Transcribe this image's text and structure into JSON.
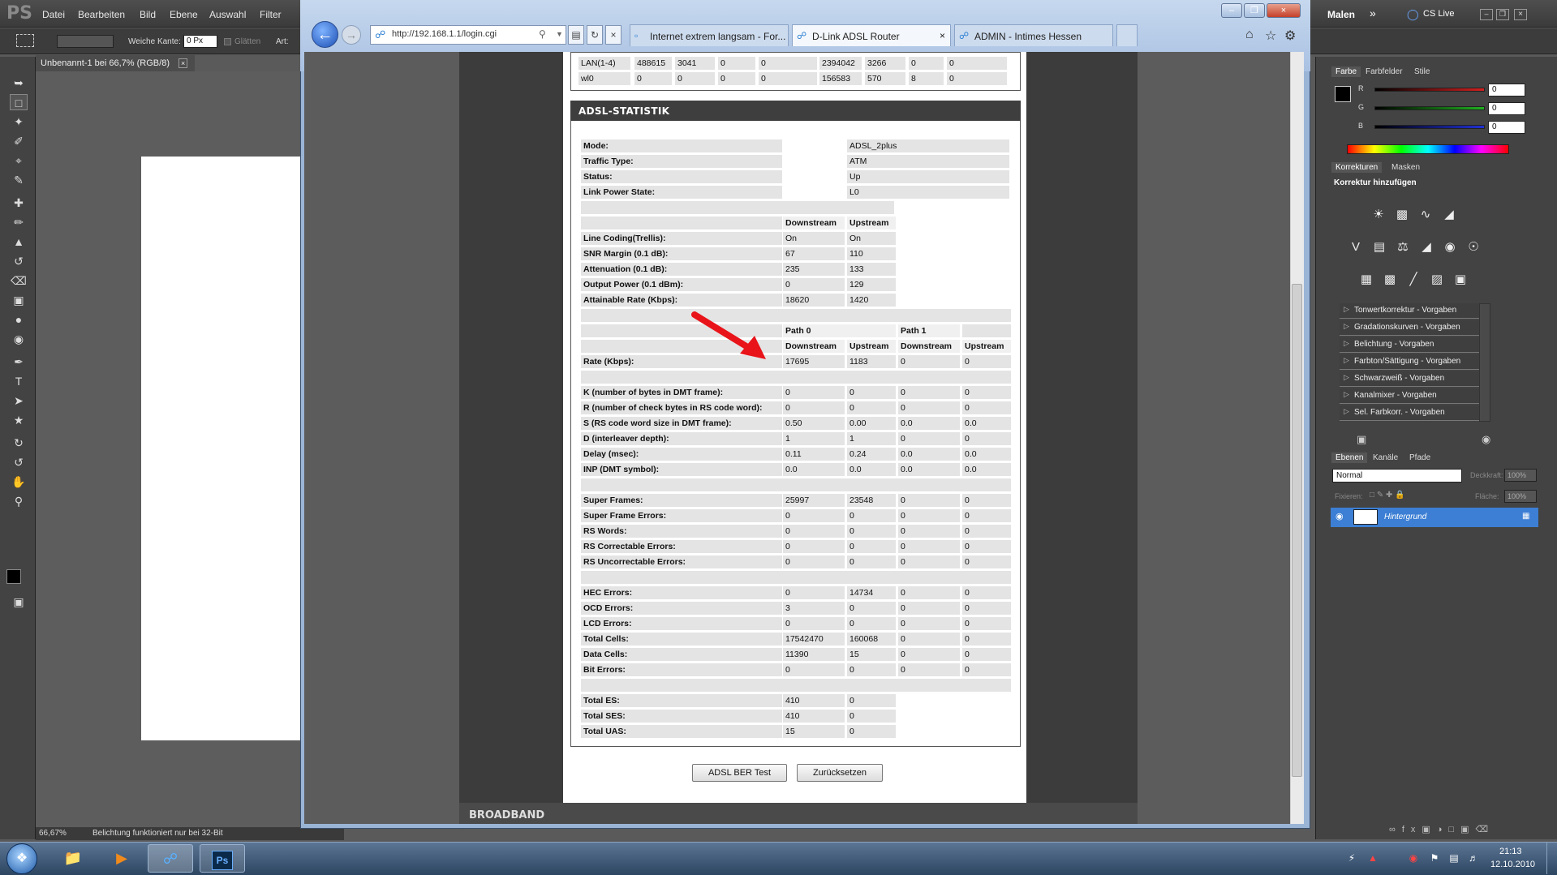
{
  "photoshop": {
    "logo": "PS",
    "menu": [
      "Datei",
      "Bearbeiten",
      "Bild",
      "Ebene",
      "Auswahl",
      "Filter"
    ],
    "options": {
      "feather_label": "Weiche Kante:",
      "feather_value": "0 Px",
      "smooth_label": "Glätten",
      "style_label": "Art:"
    },
    "doc_tab": "Unbenannt-1 bei 66,7% (RGB/8)",
    "status_zoom": "66,67%",
    "status_text": "Belichtung funktioniert nur bei 32-Bit",
    "workspace": "Malen",
    "cslive": "CS Live",
    "color_tabs": [
      "Farbe",
      "Farbfelder",
      "Stile"
    ],
    "rgb": [
      {
        "label": "R",
        "value": "0",
        "color": "#d42020"
      },
      {
        "label": "G",
        "value": "0",
        "color": "#20b020"
      },
      {
        "label": "B",
        "value": "0",
        "color": "#2030d4"
      }
    ],
    "adj_tabs": [
      "Korrekturen",
      "Masken"
    ],
    "adj_title": "Korrektur hinzufügen",
    "presets": [
      "Tonwertkorrektur - Vorgaben",
      "Gradationskurven - Vorgaben",
      "Belichtung - Vorgaben",
      "Farbton/Sättigung - Vorgaben",
      "Schwarzweiß - Vorgaben",
      "Kanalmixer - Vorgaben",
      "Sel. Farbkorr. - Vorgaben"
    ],
    "layer_tabs": [
      "Ebenen",
      "Kanäle",
      "Pfade"
    ],
    "blend_mode": "Normal",
    "opacity_label": "Deckkraft:",
    "opacity_value": "100%",
    "lock_label": "Fixieren:",
    "fill_label": "Fläche:",
    "fill_value": "100%",
    "layer_name": "Hintergrund"
  },
  "browser": {
    "url": "http://192.168.1.1/login.cgi",
    "tabs": [
      {
        "label": "Internet extrem langsam - For...",
        "active": false
      },
      {
        "label": "D-Link ADSL Router",
        "active": true
      },
      {
        "label": "ADMIN - Intimes Hessen",
        "active": false
      }
    ]
  },
  "page": {
    "top_rows": [
      [
        "LAN(1-4)",
        "488615",
        "3041",
        "0",
        "0",
        "2394042",
        "3266",
        "0",
        "0"
      ],
      [
        "wl0",
        "0",
        "0",
        "0",
        "0",
        "156583",
        "570",
        "8",
        "0"
      ]
    ],
    "section_title": "ADSL-STATISTIK",
    "basic": [
      [
        "Mode:",
        "ADSL_2plus"
      ],
      [
        "Traffic Type:",
        "ATM"
      ],
      [
        "Status:",
        "Up"
      ],
      [
        "Link Power State:",
        "L0"
      ]
    ],
    "ds_label": "Downstream",
    "us_label": "Upstream",
    "line": [
      [
        "Line Coding(Trellis):",
        "On",
        "On"
      ],
      [
        "SNR Margin (0.1 dB):",
        "67",
        "110"
      ],
      [
        "Attenuation (0.1 dB):",
        "235",
        "133"
      ],
      [
        "Output Power (0.1 dBm):",
        "0",
        "129"
      ],
      [
        "Attainable Rate (Kbps):",
        "18620",
        "1420"
      ]
    ],
    "path0": "Path 0",
    "path1": "Path 1",
    "rate": [
      "Rate (Kbps):",
      "17695",
      "1183",
      "0",
      "0"
    ],
    "params": [
      [
        "K (number of bytes in DMT frame):",
        "0",
        "0",
        "0",
        "0"
      ],
      [
        "R (number of check bytes in RS code word):",
        "0",
        "0",
        "0",
        "0"
      ],
      [
        "S (RS code word size in DMT frame):",
        "0.50",
        "0.00",
        "0.0",
        "0.0"
      ],
      [
        "D (interleaver depth):",
        "1",
        "1",
        "0",
        "0"
      ],
      [
        "Delay (msec):",
        "0.11",
        "0.24",
        "0.0",
        "0.0"
      ],
      [
        "INP (DMT symbol):",
        "0.0",
        "0.0",
        "0.0",
        "0.0"
      ]
    ],
    "frames": [
      [
        "Super Frames:",
        "25997",
        "23548",
        "0",
        "0"
      ],
      [
        "Super Frame Errors:",
        "0",
        "0",
        "0",
        "0"
      ],
      [
        "RS Words:",
        "0",
        "0",
        "0",
        "0"
      ],
      [
        "RS Correctable Errors:",
        "0",
        "0",
        "0",
        "0"
      ],
      [
        "RS Uncorrectable Errors:",
        "0",
        "0",
        "0",
        "0"
      ]
    ],
    "cells": [
      [
        "HEC Errors:",
        "0",
        "14734",
        "0",
        "0"
      ],
      [
        "OCD Errors:",
        "3",
        "0",
        "0",
        "0"
      ],
      [
        "LCD Errors:",
        "0",
        "0",
        "0",
        "0"
      ],
      [
        "Total Cells:",
        "17542470",
        "160068",
        "0",
        "0"
      ],
      [
        "Data Cells:",
        "11390",
        "15",
        "0",
        "0"
      ],
      [
        "Bit Errors:",
        "0",
        "0",
        "0",
        "0"
      ]
    ],
    "totals": [
      [
        "Total ES:",
        "410",
        "0"
      ],
      [
        "Total SES:",
        "410",
        "0"
      ],
      [
        "Total UAS:",
        "15",
        "0"
      ]
    ],
    "btn_ber": "ADSL BER Test",
    "btn_reset": "Zurücksetzen",
    "footer": "BROADBAND"
  },
  "taskbar": {
    "time": "21:13",
    "date": "12.10.2010"
  },
  "colors": {
    "annotation_arrow": "#e8141a"
  }
}
